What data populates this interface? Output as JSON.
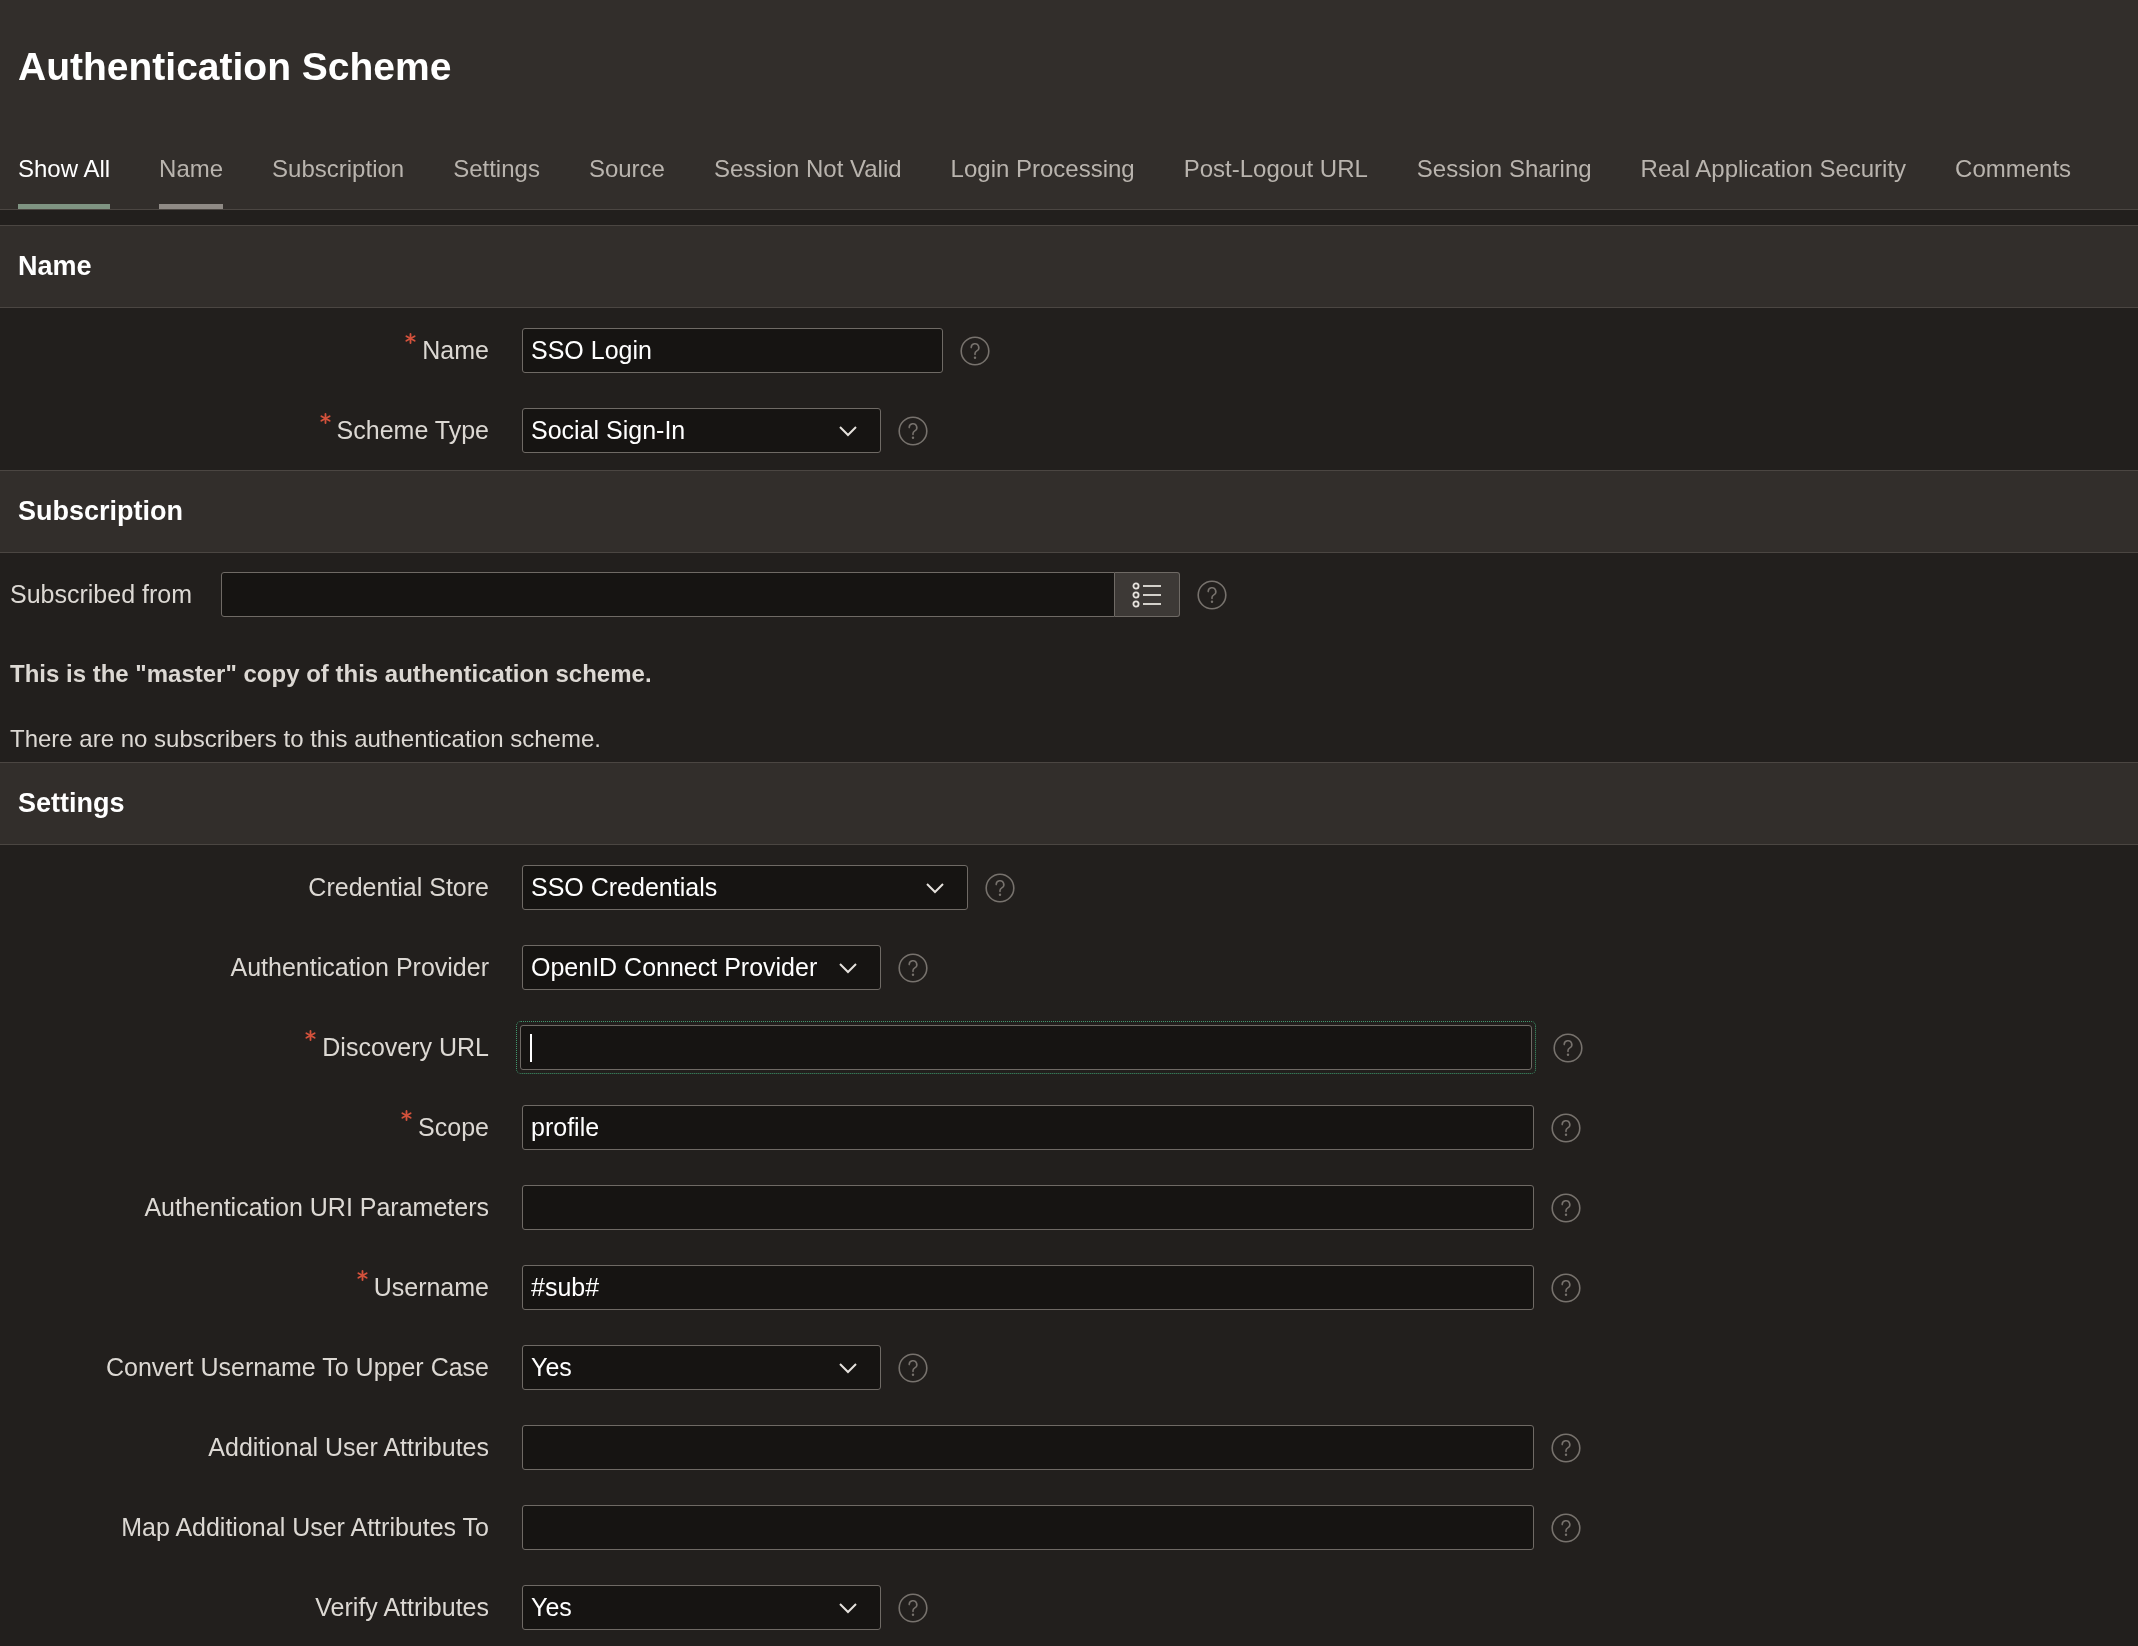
{
  "page": {
    "title": "Authentication Scheme"
  },
  "tabs": [
    {
      "label": "Show All",
      "selected": true,
      "underlined": true
    },
    {
      "label": "Name",
      "selected": false,
      "underlined": true
    },
    {
      "label": "Subscription",
      "selected": false,
      "underlined": false
    },
    {
      "label": "Settings",
      "selected": false,
      "underlined": false
    },
    {
      "label": "Source",
      "selected": false,
      "underlined": false
    },
    {
      "label": "Session Not Valid",
      "selected": false,
      "underlined": false
    },
    {
      "label": "Login Processing",
      "selected": false,
      "underlined": false
    },
    {
      "label": "Post-Logout URL",
      "selected": false,
      "underlined": false
    },
    {
      "label": "Session Sharing",
      "selected": false,
      "underlined": false
    },
    {
      "label": "Real Application Security",
      "selected": false,
      "underlined": false
    },
    {
      "label": "Comments",
      "selected": false,
      "underlined": false
    }
  ],
  "sections": [
    {
      "title": "Name",
      "kind": "form",
      "rows": [
        {
          "label": "Name",
          "required": true,
          "kind": "text",
          "value": "SSO Login",
          "focused": false
        },
        {
          "label": "Scheme Type",
          "required": true,
          "kind": "select",
          "value": "Social Sign-In",
          "focused": false
        }
      ]
    },
    {
      "title": "Subscription",
      "kind": "subscription",
      "rows": [
        {
          "label": "Subscribed from",
          "required": false,
          "kind": "lookup",
          "focused": false
        }
      ],
      "notes": [
        {
          "text": "This is the \"master\" copy of this authentication scheme.",
          "bold": true
        },
        {
          "text": "There are no subscribers to this authentication scheme.",
          "bold": false
        }
      ]
    },
    {
      "title": "Settings",
      "kind": "form",
      "rows": [
        {
          "label": "Credential Store",
          "required": false,
          "kind": "select",
          "value": "SSO Credentials",
          "focused": false
        },
        {
          "label": "Authentication Provider",
          "required": false,
          "kind": "select",
          "value": "OpenID Connect Provider",
          "focused": false
        },
        {
          "label": "Discovery URL",
          "required": true,
          "kind": "text",
          "focused": true
        },
        {
          "label": "Scope",
          "required": true,
          "kind": "text",
          "value": "profile",
          "focused": false
        },
        {
          "label": "Authentication URI Parameters",
          "required": false,
          "kind": "text",
          "focused": false
        },
        {
          "label": "Username",
          "required": true,
          "kind": "text",
          "value": "#sub#",
          "focused": false
        },
        {
          "label": "Convert Username To Upper Case",
          "required": false,
          "kind": "select",
          "value": "Yes",
          "focused": false
        },
        {
          "label": "Additional User Attributes",
          "required": false,
          "kind": "text",
          "focused": false
        },
        {
          "label": "Map Additional User Attributes To",
          "required": false,
          "kind": "text",
          "focused": false
        },
        {
          "label": "Verify Attributes",
          "required": false,
          "kind": "select",
          "value": "Yes",
          "focused": false
        }
      ]
    }
  ]
}
